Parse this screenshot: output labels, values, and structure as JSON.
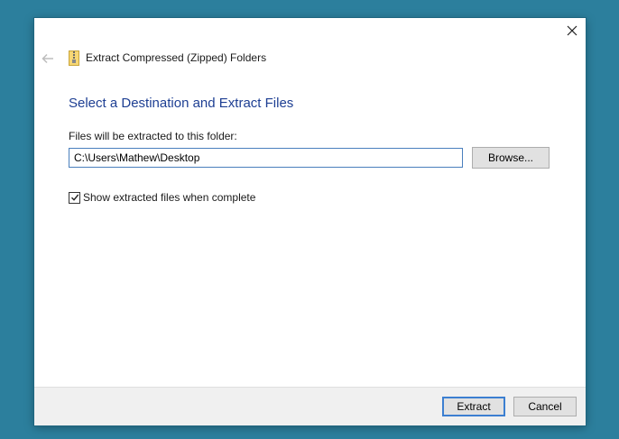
{
  "window": {
    "title": "Extract Compressed (Zipped) Folders",
    "close_icon": "close-icon",
    "back_icon": "back-arrow-icon",
    "app_icon": "zip-folder-icon"
  },
  "main": {
    "heading": "Select a Destination and Extract Files",
    "field_label": "Files will be extracted to this folder:",
    "path_value": "C:\\Users\\Mathew\\Desktop",
    "browse_label": "Browse...",
    "checkbox_label": "Show extracted files when complete",
    "checkbox_checked": true
  },
  "footer": {
    "extract_label": "Extract",
    "cancel_label": "Cancel"
  },
  "colors": {
    "desktop": "#2c7f9d",
    "heading": "#1e3f93",
    "input_border": "#4a7fbd",
    "default_button_border": "#3c7fd1",
    "footer_bg": "#f0f0f0"
  }
}
